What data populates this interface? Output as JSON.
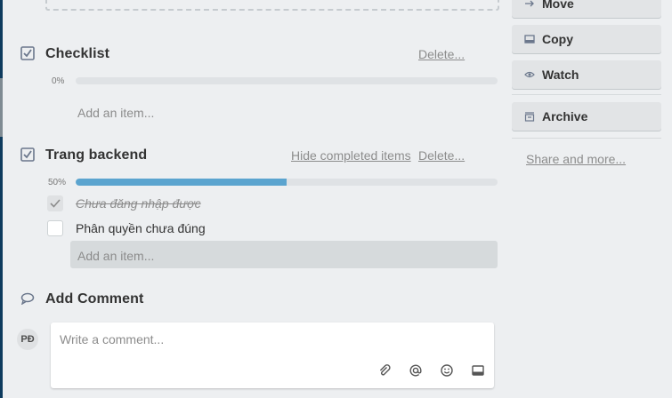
{
  "checklists": [
    {
      "title": "Checklist",
      "percent": "0%",
      "progress": 0,
      "delete_label": "Delete...",
      "add_item_placeholder": "Add an item..."
    },
    {
      "title": "Trang backend",
      "percent": "50%",
      "progress": 0.5,
      "hide_completed_label": "Hide completed items",
      "delete_label": "Delete...",
      "items": [
        {
          "text": "Chưa đăng nhập được",
          "checked": true
        },
        {
          "text": "Phân quyền chưa đúng",
          "checked": false
        }
      ],
      "add_item_placeholder": "Add an item..."
    }
  ],
  "comment": {
    "title": "Add Comment",
    "avatar_initials": "PĐ",
    "placeholder": "Write a comment...",
    "tools": [
      "attachment-icon",
      "mention-icon",
      "emoji-icon",
      "card-icon"
    ]
  },
  "sidebar": {
    "buttons": [
      {
        "label": "Move",
        "icon": "arrow-right-icon"
      },
      {
        "label": "Copy",
        "icon": "card-icon"
      },
      {
        "label": "Watch",
        "icon": "eye-icon"
      },
      {
        "label": "Archive",
        "icon": "archive-icon"
      }
    ],
    "share_label": "Share and more..."
  },
  "colors": {
    "progress_fill": "#5ba4cf",
    "progress_track": "#dfe2e5",
    "background": "#edeff1"
  }
}
